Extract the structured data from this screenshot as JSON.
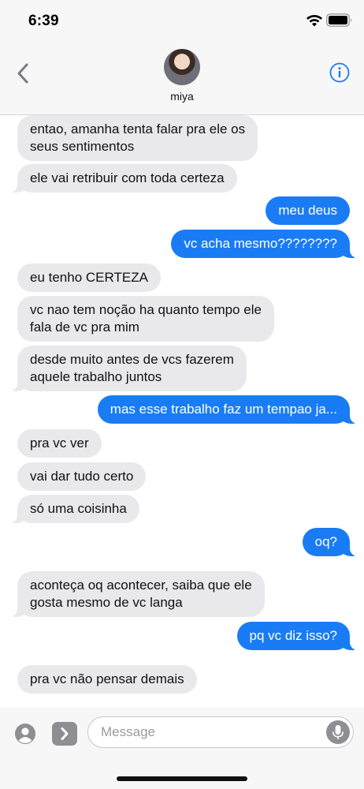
{
  "status_bar": {
    "time": "6:39"
  },
  "header": {
    "contact_name": "miya"
  },
  "messages": [
    {
      "dir": "in",
      "lines": [
        "entao, amanha tenta falar pra ele os",
        "seus sentimentos"
      ]
    },
    {
      "dir": "in",
      "lines": [
        "ele vai retribuir com toda certeza"
      ]
    },
    {
      "dir": "out",
      "lines": [
        "meu deus"
      ]
    },
    {
      "dir": "out",
      "lines": [
        "vc acha mesmo????????"
      ]
    },
    {
      "dir": "in",
      "lines": [
        "eu tenho CERTEZA"
      ]
    },
    {
      "dir": "in",
      "lines": [
        "vc nao tem noção ha quanto tempo ele",
        "fala de vc pra mim"
      ]
    },
    {
      "dir": "in",
      "lines": [
        "desde muito antes de vcs fazerem",
        "aquele trabalho juntos"
      ]
    },
    {
      "dir": "out",
      "lines": [
        "mas esse trabalho faz um tempao ja..."
      ]
    },
    {
      "dir": "in",
      "lines": [
        "pra vc ver"
      ]
    },
    {
      "dir": "in",
      "lines": [
        "vai dar tudo certo"
      ]
    },
    {
      "dir": "in",
      "lines": [
        "só uma coisinha"
      ]
    },
    {
      "dir": "out",
      "lines": [
        "oq?"
      ]
    },
    {
      "dir": "in",
      "lines": [
        "aconteça oq acontecer, saiba que ele",
        "gosta mesmo de vc langa"
      ]
    },
    {
      "dir": "out",
      "lines": [
        "pq vc diz isso?"
      ]
    },
    {
      "dir": "in",
      "lines": [
        "pra vc não pensar demais"
      ]
    }
  ],
  "composer": {
    "placeholder": "Message"
  },
  "colors": {
    "accent": "#1a7cf5",
    "incoming_bubble": "#e9e9eb",
    "outgoing_bubble": "#1a7cf5",
    "bar_background": "#f7f7f7"
  }
}
